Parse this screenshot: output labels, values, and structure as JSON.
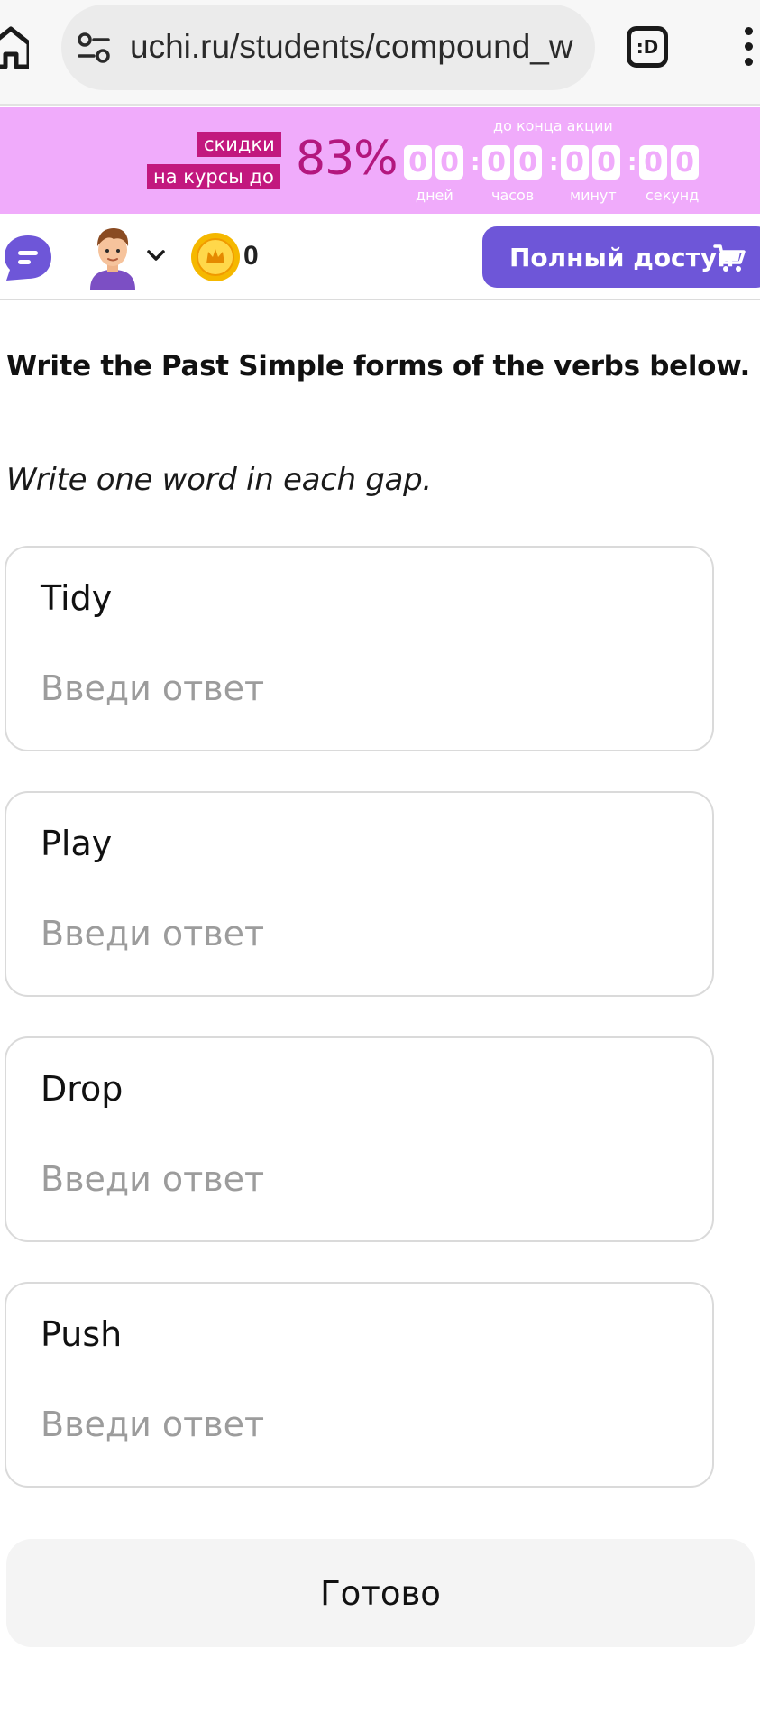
{
  "browser": {
    "url": "uchi.ru/students/compound_w",
    "tabs_icon_label": ":D"
  },
  "promo": {
    "label_line1": "скидки",
    "label_line2": "на курсы до",
    "percent": "83%",
    "until_label": "до конца акции",
    "timer": {
      "days": [
        "0",
        "0"
      ],
      "hours": [
        "0",
        "0"
      ],
      "minutes": [
        "0",
        "0"
      ],
      "seconds": [
        "0",
        "0"
      ],
      "days_label": "дней",
      "hours_label": "часов",
      "minutes_label": "минут",
      "seconds_label": "секунд",
      "separator": ":"
    },
    "colors": {
      "banner": "#f0abfb",
      "accent": "#c2187e"
    }
  },
  "header": {
    "coins": "0",
    "full_access_label": "Полный доступ",
    "colors": {
      "button": "#6e56d8",
      "chat": "#6e56d8",
      "coin": "#f5b800"
    }
  },
  "exercise": {
    "title": "Write the Past Simple forms of the verbs below.",
    "instruction": "Write one word in each gap.",
    "items": [
      {
        "verb": "Tidy",
        "placeholder": "Введи ответ",
        "value": ""
      },
      {
        "verb": "Play",
        "placeholder": "Введи ответ",
        "value": ""
      },
      {
        "verb": "Drop",
        "placeholder": "Введи ответ",
        "value": ""
      },
      {
        "verb": "Push",
        "placeholder": "Введи ответ",
        "value": ""
      }
    ],
    "submit_label": "Готово"
  }
}
